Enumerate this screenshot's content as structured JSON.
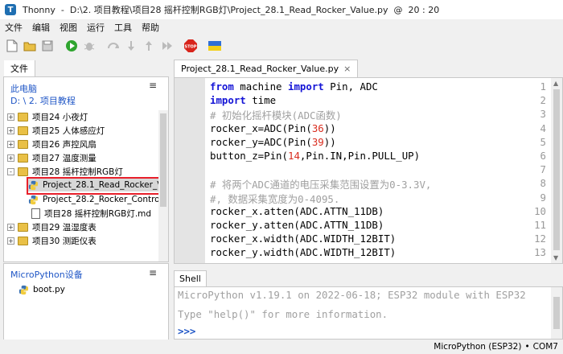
{
  "window": {
    "app_name": "Thonny",
    "title_sep": "-",
    "file_path": "D:\\2. 项目教程\\项目28 摇杆控制RGB灯\\Project_28.1_Read_Rocker_Value.py",
    "at": "@",
    "cursor_pos": "20 : 20"
  },
  "menu": [
    "文件",
    "编辑",
    "视图",
    "运行",
    "工具",
    "帮助"
  ],
  "files_panel": {
    "tab_label": "文件",
    "computer_label": "此电脑",
    "path_label": "D: \\ 2. 项目教程",
    "items": [
      {
        "label": "项目24 小夜灯",
        "type": "folder",
        "expander": "+"
      },
      {
        "label": "项目25 人体感应灯",
        "type": "folder",
        "expander": "+"
      },
      {
        "label": "项目26 声控风扇",
        "type": "folder",
        "expander": "+"
      },
      {
        "label": "项目27 温度测量",
        "type": "folder",
        "expander": "+"
      },
      {
        "label": "项目28 摇杆控制RGB灯",
        "type": "folder",
        "expander": "-"
      },
      {
        "label": "Project_28.1_Read_Rocker_V",
        "type": "py"
      },
      {
        "label": "Project_28.2_Rocker_Contro",
        "type": "py"
      },
      {
        "label": "项目28 摇杆控制RGB灯.md",
        "type": "md"
      },
      {
        "label": "项目29 温湿度表",
        "type": "folder",
        "expander": "+"
      },
      {
        "label": "项目30 测距仪表",
        "type": "folder",
        "expander": "+"
      }
    ]
  },
  "device_panel": {
    "title": "MicroPython设备",
    "files": [
      "boot.py"
    ]
  },
  "editor": {
    "tab_label": "Project_28.1_Read_Rocker_Value.py",
    "tab_close": "×",
    "line_numbers": [
      "1",
      "2",
      "3",
      "4",
      "5",
      "6",
      "7",
      "8",
      "9",
      "10",
      "11",
      "12",
      "13"
    ],
    "lines": [
      [
        [
          "kw",
          "from"
        ],
        [
          "t",
          " machine "
        ],
        [
          "kw",
          "import"
        ],
        [
          "t",
          " Pin, ADC"
        ]
      ],
      [
        [
          "kw",
          "import"
        ],
        [
          "t",
          " time"
        ]
      ],
      [
        [
          "cmt",
          "# 初始化摇杆模块(ADC函数)"
        ]
      ],
      [
        [
          "t",
          "rocker_x=ADC(Pin("
        ],
        [
          "num",
          "36"
        ],
        [
          "t",
          "))"
        ]
      ],
      [
        [
          "t",
          "rocker_y=ADC(Pin("
        ],
        [
          "num",
          "39"
        ],
        [
          "t",
          "))"
        ]
      ],
      [
        [
          "t",
          "button_z=Pin("
        ],
        [
          "num",
          "14"
        ],
        [
          "t",
          ",Pin.IN,Pin.PULL_UP)"
        ]
      ],
      [
        [
          "t",
          ""
        ]
      ],
      [
        [
          "cmt",
          "# 将两个ADC通道的电压采集范围设置为0-3.3V,"
        ]
      ],
      [
        [
          "cmt",
          "#, 数据采集宽度为0-4095."
        ]
      ],
      [
        [
          "t",
          "rocker_x.atten(ADC.ATTN_11DB)"
        ]
      ],
      [
        [
          "t",
          "rocker_y.atten(ADC.ATTN_11DB)"
        ]
      ],
      [
        [
          "t",
          "rocker_x.width(ADC.WIDTH_12BIT)"
        ]
      ],
      [
        [
          "t",
          "rocker_y.width(ADC.WIDTH_12BIT)"
        ]
      ]
    ]
  },
  "shell": {
    "tab_label": "Shell",
    "line1": "MicroPython v1.19.1 on 2022-06-18; ESP32 module with ESP32",
    "line2": "Type \"help()\" for more information.",
    "prompt": ">>>"
  },
  "status": {
    "interpreter": "MicroPython (ESP32)",
    "separator": "•",
    "port": "COM7"
  },
  "colors": {
    "keyword": "#1414d6",
    "number": "#d92c1e",
    "comment": "#a0a0a0",
    "link": "#1f56c6",
    "highlight": "#e8202b"
  },
  "icons": [
    "new-file-icon",
    "open-file-icon",
    "save-icon",
    "run-icon",
    "debug-icon",
    "step-over-icon",
    "step-into-icon",
    "step-out-icon",
    "resume-icon",
    "stop-icon",
    "ukraine-flag-icon"
  ]
}
